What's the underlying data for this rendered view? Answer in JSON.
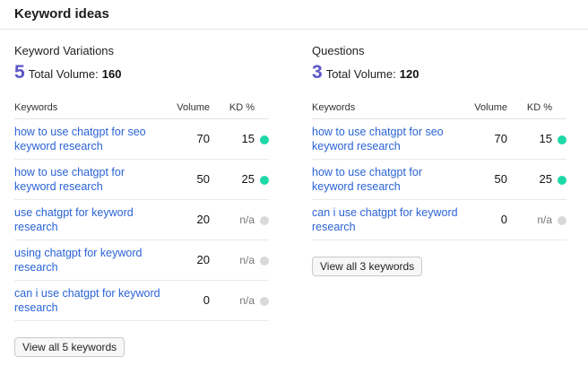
{
  "header": {
    "title": "Keyword ideas"
  },
  "panels": [
    {
      "title": "Keyword Variations",
      "count": "5",
      "total_label": "Total Volume:",
      "total_value": "160",
      "columns": {
        "keywords": "Keywords",
        "volume": "Volume",
        "kd": "KD %"
      },
      "rows": [
        {
          "keyword": "how to use chatgpt for seo keyword research",
          "volume": "70",
          "kd": "15",
          "kd_status": "green"
        },
        {
          "keyword": "how to use chatgpt for keyword research",
          "volume": "50",
          "kd": "25",
          "kd_status": "green"
        },
        {
          "keyword": "use chatgpt for keyword research",
          "volume": "20",
          "kd": "n/a",
          "kd_status": "gray"
        },
        {
          "keyword": "using chatgpt for keyword research",
          "volume": "20",
          "kd": "n/a",
          "kd_status": "gray"
        },
        {
          "keyword": "can i use chatgpt for keyword research",
          "volume": "0",
          "kd": "n/a",
          "kd_status": "gray"
        }
      ],
      "view_all_label": "View all 5 keywords"
    },
    {
      "title": "Questions",
      "count": "3",
      "total_label": "Total Volume:",
      "total_value": "120",
      "columns": {
        "keywords": "Keywords",
        "volume": "Volume",
        "kd": "KD %"
      },
      "rows": [
        {
          "keyword": "how to use chatgpt for seo keyword research",
          "volume": "70",
          "kd": "15",
          "kd_status": "green"
        },
        {
          "keyword": "how to use chatgpt for keyword research",
          "volume": "50",
          "kd": "25",
          "kd_status": "green"
        },
        {
          "keyword": "can i use chatgpt for keyword research",
          "volume": "0",
          "kd": "n/a",
          "kd_status": "gray"
        }
      ],
      "view_all_label": "View all 3 keywords"
    }
  ],
  "colors": {
    "accent": "#5b56c8",
    "link": "#2a63d6",
    "kd_green": "#1fd8a8",
    "kd_gray": "#d9d9d9"
  }
}
